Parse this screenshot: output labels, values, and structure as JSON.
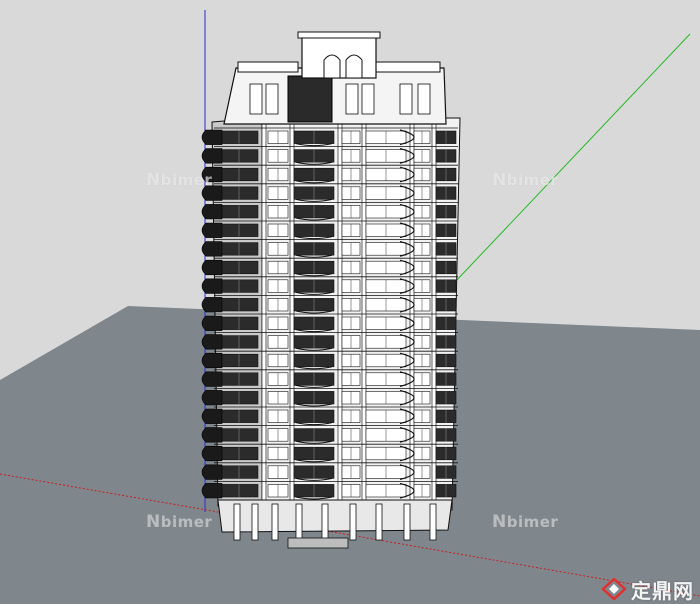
{
  "viewport": {
    "background_color": "#d9d9d9",
    "ground_color": "#7f868c",
    "axis_colors": {
      "red": "#cc2020",
      "green": "#22bb22",
      "blue": "#2a2ad0"
    }
  },
  "model": {
    "kind": "residential-tower",
    "floors": 20,
    "style": "neoclassical high-rise, wireframe render"
  },
  "watermarks": [
    {
      "id": "wm-1",
      "text": "bimer"
    },
    {
      "id": "wm-2",
      "text": "bimer"
    },
    {
      "id": "wm-3",
      "text": "bimer"
    },
    {
      "id": "wm-4",
      "text": "bimer"
    }
  ],
  "brand": {
    "logo_icon": "diamond-logo-icon",
    "text": "定鼎网"
  }
}
